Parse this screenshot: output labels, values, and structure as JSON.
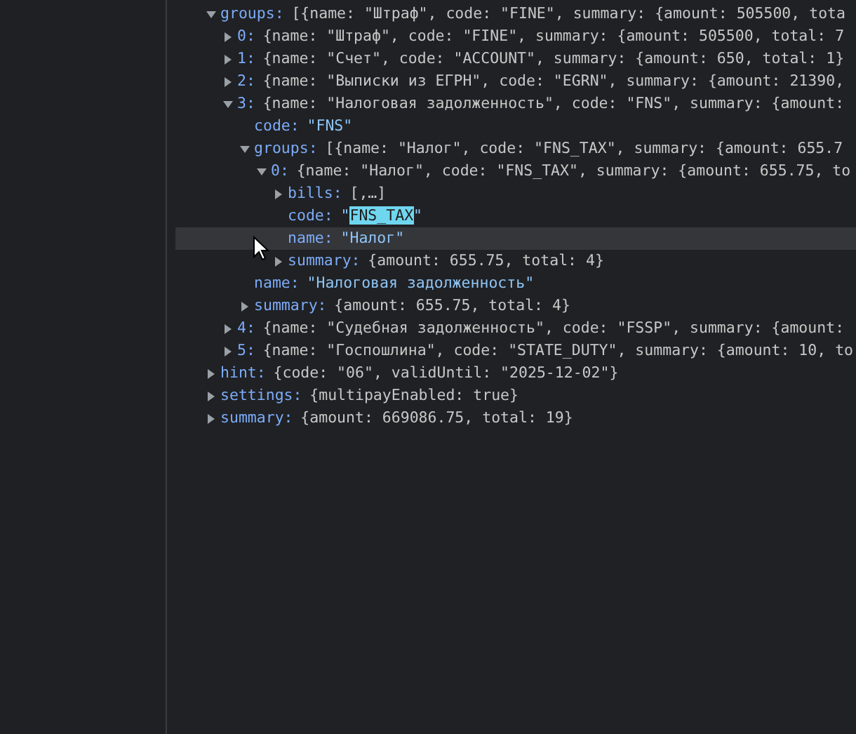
{
  "tree": [
    {
      "key": "groups:",
      "kind": "object",
      "expanded": true,
      "hovered": false,
      "value": "[{name: \"Штраф\", code: \"FINE\", summary: {amount: 505500, tota",
      "children": [
        {
          "key": "0:",
          "kind": "object",
          "expanded": false,
          "hovered": false,
          "value": "{name: \"Штраф\", code: \"FINE\", summary: {amount: 505500, total: 7"
        },
        {
          "key": "1:",
          "kind": "object",
          "expanded": false,
          "hovered": false,
          "value": "{name: \"Счет\", code: \"ACCOUNT\", summary: {amount: 650, total: 1}"
        },
        {
          "key": "2:",
          "kind": "object",
          "expanded": false,
          "hovered": false,
          "value": "{name: \"Выписки из ЕГРН\", code: \"EGRN\", summary: {amount: 21390,"
        },
        {
          "key": "3:",
          "kind": "object",
          "expanded": true,
          "hovered": false,
          "value": "{name: \"Налоговая задолженность\", code: \"FNS\", summary: {amount:",
          "children": [
            {
              "key": "code:",
              "kind": "leaf",
              "hovered": false,
              "value": "\"FNS\""
            },
            {
              "key": "groups:",
              "kind": "object",
              "expanded": true,
              "hovered": false,
              "value": "[{name: \"Налог\", code: \"FNS_TAX\", summary: {amount: 655.7",
              "children": [
                {
                  "key": "0:",
                  "kind": "object",
                  "expanded": true,
                  "hovered": false,
                  "value": "{name: \"Налог\", code: \"FNS_TAX\", summary: {amount: 655.75, to",
                  "children": [
                    {
                      "key": "bills:",
                      "kind": "object",
                      "expanded": false,
                      "hovered": false,
                      "value": "[,…]"
                    },
                    {
                      "key": "code:",
                      "kind": "leaf",
                      "hovered": false,
                      "value_parts": [
                        {
                          "text": "\"",
                          "highlighted": false
                        },
                        {
                          "text": "FNS_TAX",
                          "highlighted": true
                        },
                        {
                          "text": "\"",
                          "highlighted": false
                        }
                      ]
                    },
                    {
                      "key": "name:",
                      "kind": "leaf",
                      "hovered": true,
                      "value": "\"Налог\""
                    },
                    {
                      "key": "summary:",
                      "kind": "object",
                      "expanded": false,
                      "hovered": false,
                      "value": "{amount: 655.75, total: 4}"
                    }
                  ]
                }
              ]
            },
            {
              "key": "name:",
              "kind": "leaf",
              "hovered": false,
              "value": "\"Налоговая задолженность\""
            },
            {
              "key": "summary:",
              "kind": "object",
              "expanded": false,
              "hovered": false,
              "value": "{amount: 655.75, total: 4}"
            }
          ]
        },
        {
          "key": "4:",
          "kind": "object",
          "expanded": false,
          "hovered": false,
          "value": "{name: \"Судебная задолженность\", code: \"FSSP\", summary: {amount:"
        },
        {
          "key": "5:",
          "kind": "object",
          "expanded": false,
          "hovered": false,
          "value": "{name: \"Госпошлина\", code: \"STATE_DUTY\", summary: {amount: 10, to"
        }
      ]
    },
    {
      "key": "hint:",
      "kind": "object",
      "expanded": false,
      "hovered": false,
      "value": "{code: \"06\", validUntil: \"2025-12-02\"}"
    },
    {
      "key": "settings:",
      "kind": "object",
      "expanded": false,
      "hovered": false,
      "value": "{multipayEnabled: true}"
    },
    {
      "key": "summary:",
      "kind": "object",
      "expanded": false,
      "hovered": false,
      "value": "{amount: 669086.75, total: 19}"
    }
  ]
}
